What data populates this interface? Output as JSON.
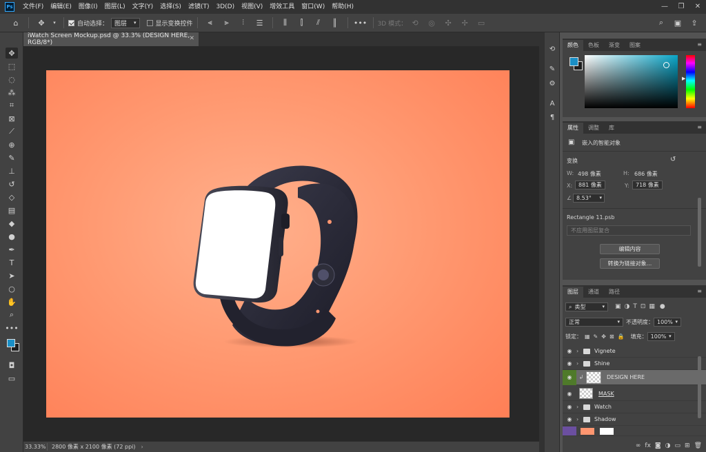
{
  "app": {
    "logo": "Ps"
  },
  "menu": [
    "文件(F)",
    "编辑(E)",
    "图像(I)",
    "图层(L)",
    "文字(Y)",
    "选择(S)",
    "滤镜(T)",
    "3D(D)",
    "视图(V)",
    "增效工具",
    "窗口(W)",
    "帮助(H)"
  ],
  "window_controls": {
    "minimize": "—",
    "maximize": "❐",
    "close": "✕"
  },
  "options": {
    "auto_select_label": "自动选择：",
    "auto_select_target": "图层",
    "show_transform_label": "显示变换控件",
    "mode_3d_label": "3D 模式："
  },
  "document": {
    "tab_title": "iWatch Screen Mockup.psd @ 33.3% (DESIGN HERE, RGB/8*)",
    "zoom": "33.33%",
    "size": "2800 像素 x 2100 像素 (72 ppi)",
    "canvas_color_center": "#ffb08c",
    "canvas_color_edge": "#ff7f56"
  },
  "color_panel": {
    "tabs": [
      "颜色",
      "色板",
      "渐变",
      "图案"
    ],
    "foreground": "#1a8fc6",
    "background": "#1e1e1e"
  },
  "properties_panel": {
    "tabs": [
      "属性",
      "调整",
      "库"
    ],
    "object_type": "嵌入的智能对象",
    "transform_label": "变换",
    "w_label": "W:",
    "w_value": "498 像素",
    "h_label": "H:",
    "h_value": "686 像素",
    "x_label": "X:",
    "x_value": "881 像素",
    "y_label": "Y:",
    "y_value": "718 像素",
    "angle": "8.53°",
    "source_file": "Rectangle 11.psb",
    "layer_comp": "不应用图层复合",
    "edit_contents": "编辑内容",
    "convert_linked": "转换为链接对象..."
  },
  "layers_panel": {
    "tabs": [
      "图层",
      "通道",
      "路径"
    ],
    "filter_kind": "类型",
    "blend_mode": "正常",
    "opacity_label": "不透明度：",
    "opacity_value": "100%",
    "lock_label": "锁定：",
    "fill_label": "填充：",
    "fill_value": "100%",
    "layers": [
      {
        "name": "Vignete",
        "type": "group"
      },
      {
        "name": "Shine",
        "type": "group"
      },
      {
        "name": "DESIGN HERE",
        "type": "smart-object",
        "selected": true
      },
      {
        "name": "MASK",
        "type": "pixel"
      },
      {
        "name": "Watch",
        "type": "group"
      },
      {
        "name": "Shadow",
        "type": "group"
      }
    ]
  },
  "icons": [
    "move-tool-icon",
    "marquee-icon",
    "lasso-icon",
    "magic-wand-icon",
    "crop-icon",
    "frame-icon",
    "eyedropper-icon",
    "healing-icon",
    "brush-icon",
    "stamp-icon",
    "history-brush-icon",
    "eraser-icon",
    "gradient-icon",
    "blur-icon",
    "dodge-icon",
    "pen-icon",
    "type-icon",
    "path-select-icon",
    "ellipse-icon",
    "hand-icon",
    "zoom-icon",
    "more-icon"
  ]
}
